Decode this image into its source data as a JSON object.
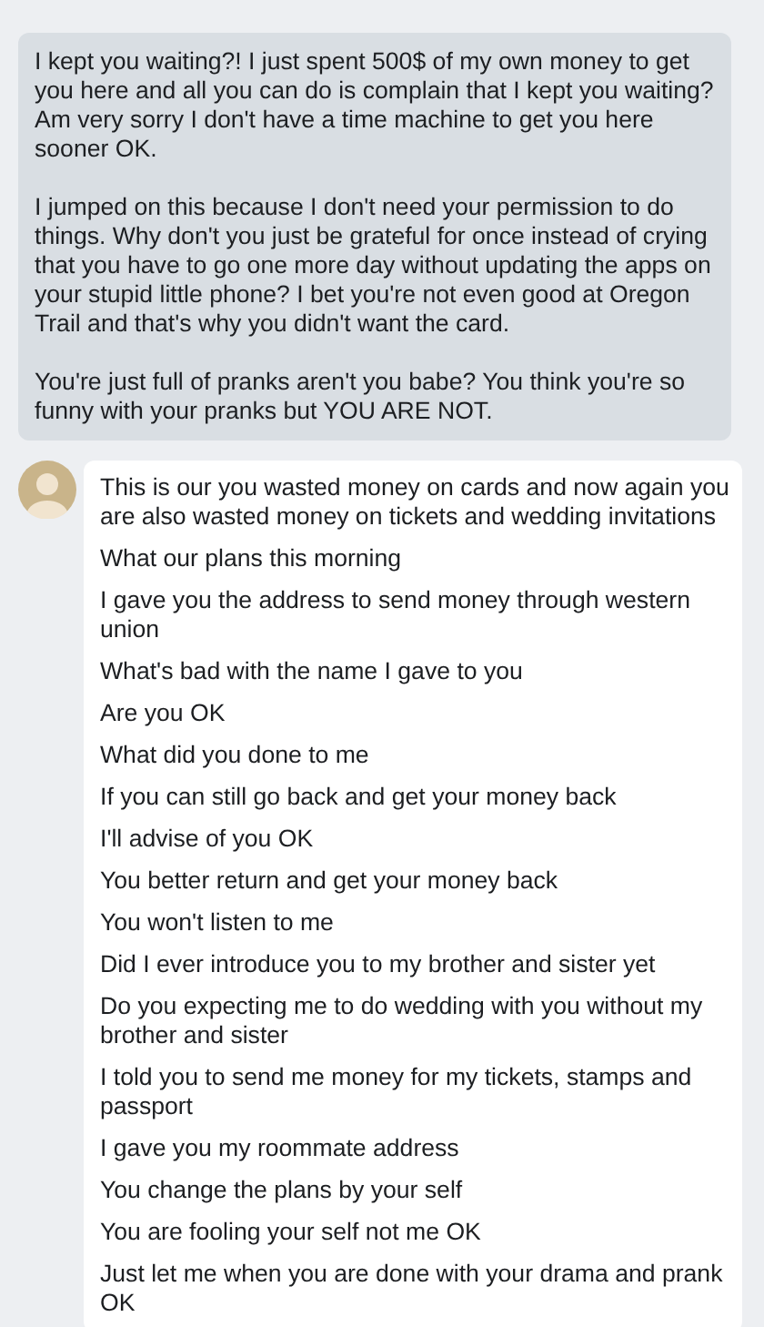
{
  "sent_message": {
    "paragraphs": [
      "I kept you waiting?! I just spent 500$ of my own money to get you here and all you can do is complain that I kept you waiting? Am very sorry I don't have a time machine to get you here sooner OK.",
      "I jumped on this because I don't need your permission to do things. Why don't you just be grateful for once instead of crying that you have to go one more day without updating the apps on your stupid little phone? I bet you're not even good at Oregon Trail and that's why you didn't want the card.",
      "You're just full of pranks aren't you babe? You think you're so funny with your pranks but YOU ARE NOT."
    ]
  },
  "received_messages": [
    "This is our you wasted money on cards and now again you are also wasted money on tickets and wedding invitations",
    "What our plans this morning",
    "I gave you the address to send money through western union",
    "What's bad with the name I gave to you",
    "Are you OK",
    "What did you done to me",
    "If you can still go back and get your money back",
    "I'll advise of you OK",
    "You better return and get your money back",
    "You won't listen to me",
    "Did I ever introduce you to my brother and sister yet",
    "Do you expecting me to do wedding with you without my brother and sister",
    "I told you to send me money for my tickets, stamps and passport",
    "I gave you my roommate address",
    "You change the plans by your self",
    "You are fooling your self not me OK",
    "Just let me when you are done with your drama and prank OK"
  ]
}
